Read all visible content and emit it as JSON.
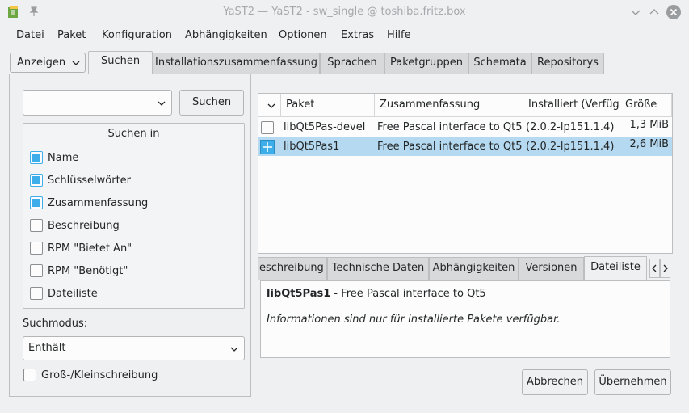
{
  "window": {
    "title": "YaST2 — YaST2 - sw_single @ toshiba.fritz.box"
  },
  "menu": [
    "Datei",
    "Paket",
    "Konfiguration",
    "Abhängigkeiten",
    "Optionen",
    "Extras",
    "Hilfe"
  ],
  "tabs": {
    "view_dropdown": "Anzeigen",
    "items": [
      "Suchen",
      "Installationszusammenfassung",
      "Sprachen",
      "Paketgruppen",
      "Schemata",
      "Repositorys"
    ],
    "active": "Suchen"
  },
  "search": {
    "input_value": "",
    "button_label": "Suchen",
    "group_title": "Suchen in",
    "options": [
      {
        "label": "Name",
        "checked": true
      },
      {
        "label": "Schlüsselwörter",
        "checked": true
      },
      {
        "label": "Zusammenfassung",
        "checked": true
      },
      {
        "label": "Beschreibung",
        "checked": false
      },
      {
        "label": "RPM \"Bietet An\"",
        "checked": false
      },
      {
        "label": "RPM \"Benötigt\"",
        "checked": false
      },
      {
        "label": "Dateiliste",
        "checked": false
      }
    ],
    "mode_label": "Suchmodus:",
    "mode_value": "Enthält",
    "case_label": "Groß-/Kleinschreibung"
  },
  "table": {
    "columns": [
      "Paket",
      "Zusammenfassung",
      "Installiert (Verfügl",
      "Größe"
    ],
    "rows": [
      {
        "name": "libQt5Pas-devel",
        "summary": "Free Pascal interface to Qt5",
        "version": "(2.0.2-lp151.1.4)",
        "size": "1,3 MiB",
        "status": "none"
      },
      {
        "name": "libQt5Pas1",
        "summary": "Free Pascal interface to Qt5",
        "version": "(2.0.2-lp151.1.4)",
        "size": "2,6 MiB",
        "status": "install"
      }
    ]
  },
  "details": {
    "tabs": [
      "eschreibung",
      "Technische Daten",
      "Abhängigkeiten",
      "Versionen",
      "Dateiliste"
    ],
    "active": "Dateiliste",
    "package_name": "libQt5Pas1",
    "package_summary": " - Free Pascal interface to Qt5",
    "message": "Informationen sind nur für installierte Pakete verfügbar."
  },
  "buttons": {
    "cancel": "Abbrechen",
    "accept": "Übernehmen"
  },
  "colors": {
    "accent": "#3daee9",
    "selection": "#b5d9f0"
  }
}
